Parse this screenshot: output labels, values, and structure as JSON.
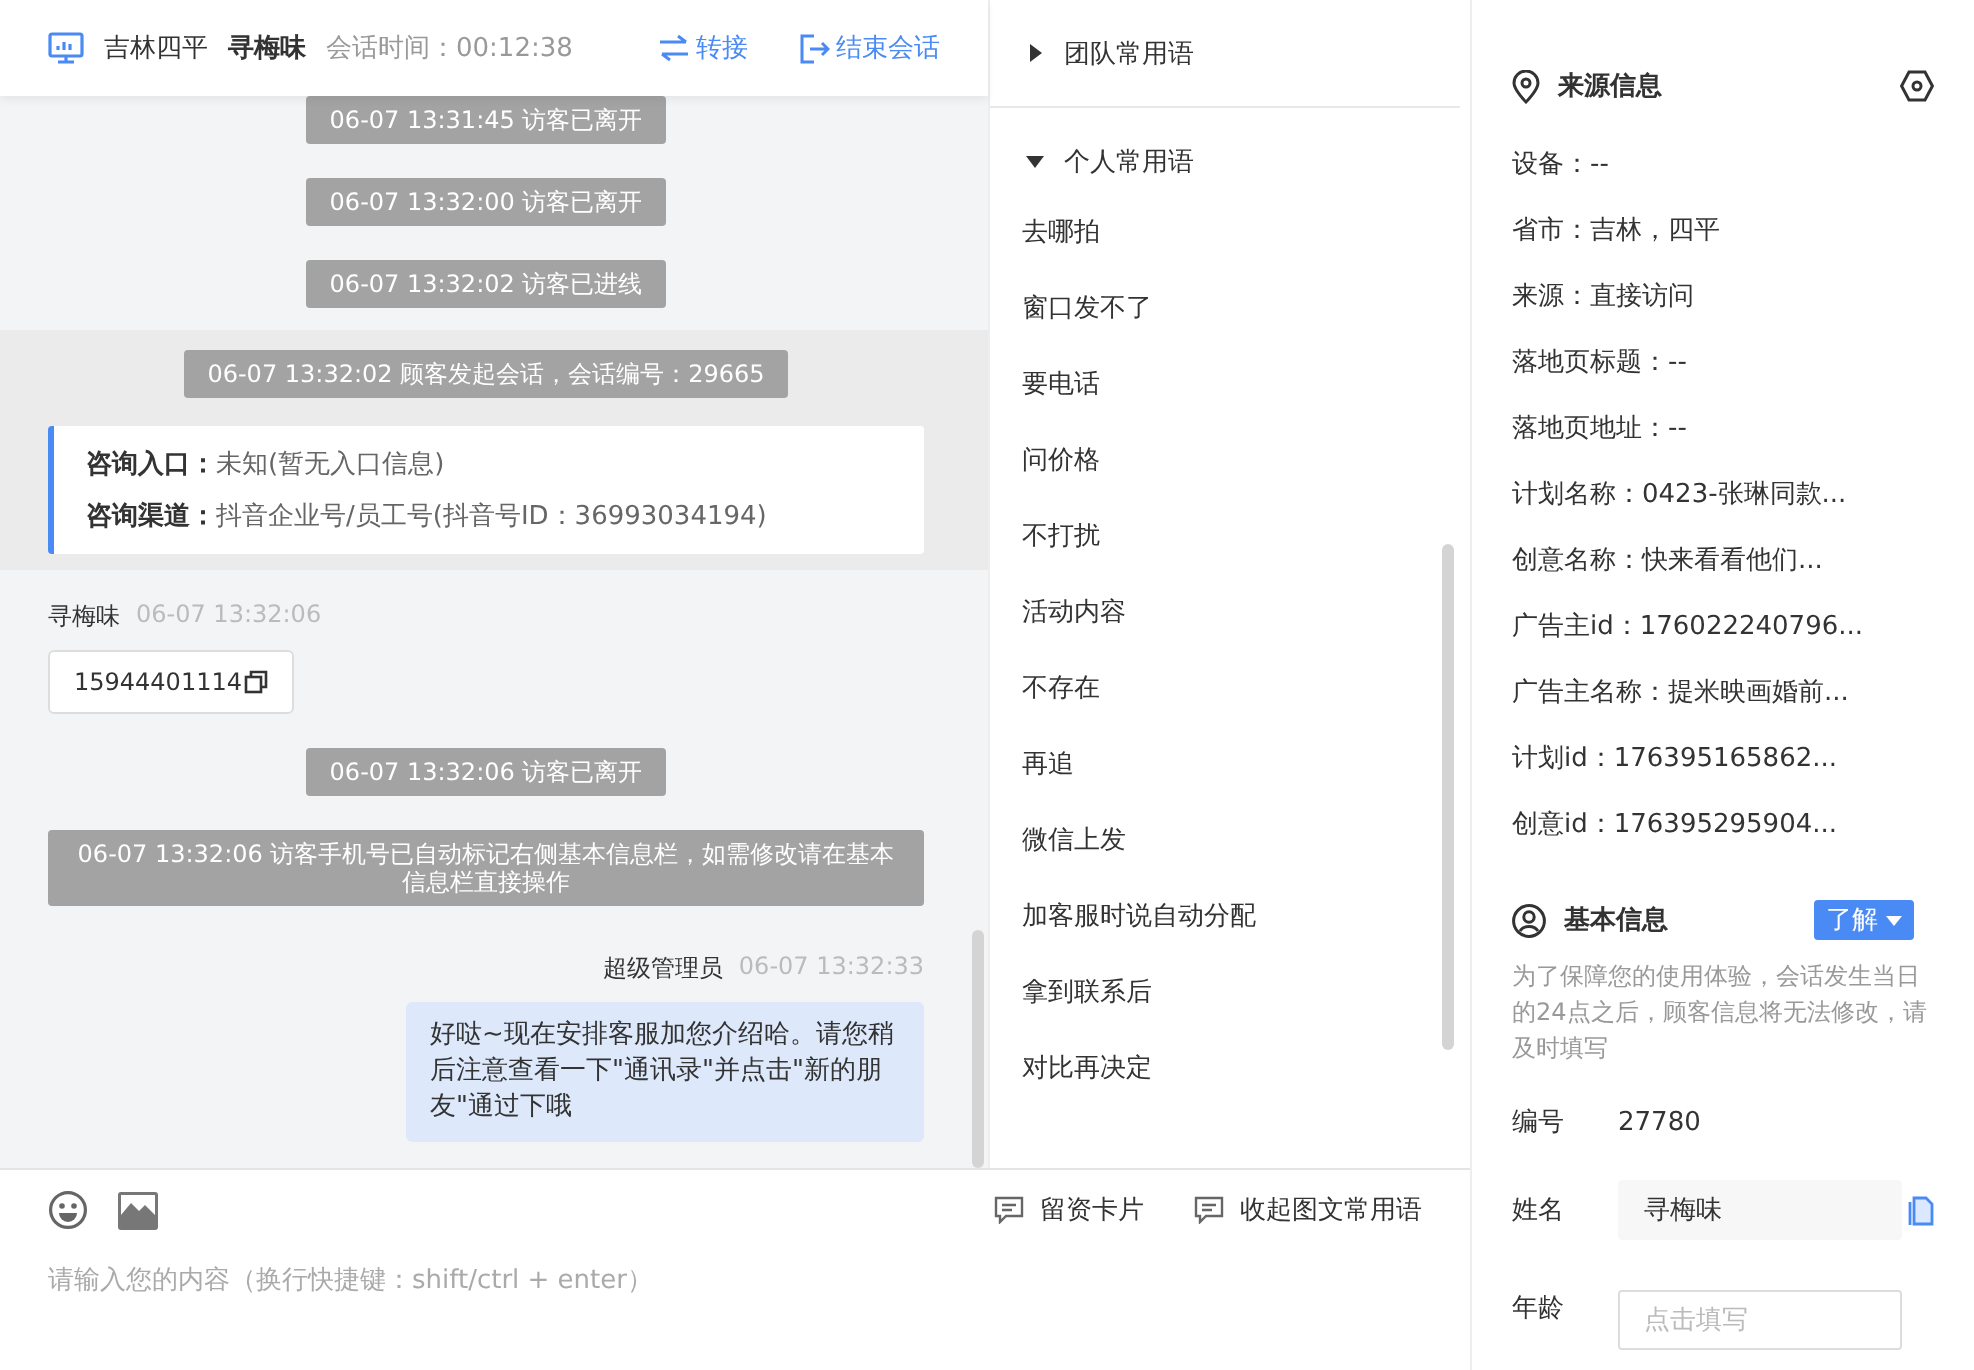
{
  "header": {
    "location": "吉林四平",
    "visitor": "寻梅味",
    "session_time": "会话时间：00:12:38",
    "actions": [
      {
        "kind": "transfer",
        "label": "转接"
      },
      {
        "kind": "end",
        "label": "结束会话"
      }
    ]
  },
  "messages": [
    {
      "kind": "system",
      "text": "06-07 13:31:45 访客已离开"
    },
    {
      "kind": "system",
      "text": "06-07 13:32:00 访客已离开"
    },
    {
      "kind": "system",
      "text": "06-07 13:32:02 访客已进线"
    },
    {
      "kind": "session",
      "text": "06-07 13:32:02 顾客发起会话，会话编号：29665",
      "info": [
        {
          "label": "咨询入口：",
          "value": "未知(暂无入口信息)"
        },
        {
          "label": "咨询渠道：",
          "value": "抖音企业号/员工号(抖音号ID：36993034194)"
        }
      ]
    },
    {
      "kind": "visitor",
      "sender": "寻梅味",
      "time": "06-07 13:32:06",
      "text": "15944401114"
    },
    {
      "kind": "system",
      "text": "06-07 13:32:06 访客已离开"
    },
    {
      "kind": "system",
      "text": "06-07 13:32:06 访客手机号已自动标记右侧基本信息栏，如需修改请在基本信息栏直接操作"
    },
    {
      "kind": "agent",
      "sender": "超级管理员",
      "time": "06-07 13:32:33",
      "text": "好哒~现在安排客服加您介绍哈。请您稍后注意查看一下\"通讯录\"并点击\"新的朋友\"通过下哦"
    }
  ],
  "composer": {
    "placeholder": "请输入您的内容（换行快捷键：shift/ctrl + enter）",
    "actions": [
      "留资卡片",
      "收起图文常用语"
    ]
  },
  "phrase_groups": [
    {
      "label": "团队常用语",
      "expanded": false
    },
    {
      "label": "个人常用语",
      "expanded": true,
      "items": [
        "去哪拍",
        "窗口发不了",
        "要电话",
        "问价格",
        "不打扰",
        "活动内容",
        "不存在",
        "再追",
        "微信上发",
        "加客服时说自动分配",
        "拿到联系后",
        "对比再决定"
      ]
    }
  ],
  "source_info": {
    "title": "来源信息",
    "rows": [
      "设备：--",
      "省市：吉林，四平",
      "来源：直接访问",
      "落地页标题：--",
      "落地页地址：--",
      "计划名称：0423-张琳同款...",
      "创意名称：快来看看他们...",
      "广告主id：176022240796...",
      "广告主名称：提米映画婚前...",
      "计划id：176395165862...",
      "创意id：176395295904..."
    ]
  },
  "basic_info": {
    "title": "基本信息",
    "dropdown": "了解",
    "note": "为了保障您的使用体验，会话发生当日的24点之后，顾客信息将无法修改，请及时填写",
    "fields": [
      {
        "kind": "text",
        "label": "编号",
        "value": "27780"
      },
      {
        "kind": "input",
        "label": "姓名",
        "value": "寻梅味"
      },
      {
        "kind": "input",
        "label": "年龄",
        "placeholder": "点击填写"
      }
    ]
  }
}
